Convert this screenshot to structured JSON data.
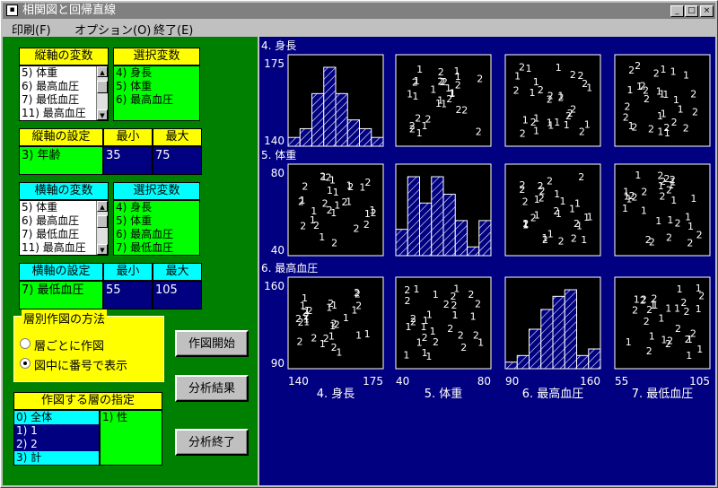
{
  "window": {
    "title": "相関図と回帰直線",
    "min_glyph": "_",
    "max_glyph": "□",
    "close_glyph": "×"
  },
  "menu": [
    "印刷(F)",
    "オプション(O)",
    "終了(E)"
  ],
  "vertical_vars": {
    "header": "縦軸の変数",
    "items": [
      "5) 体重",
      "6) 最高血圧",
      "7) 最低血圧",
      "11) 最高血圧"
    ]
  },
  "vertical_selected": {
    "header": "選択変数",
    "items": [
      "4) 身長",
      "5) 体重",
      "6) 最高血圧"
    ]
  },
  "vertical_setting": {
    "header": "縦軸の設定",
    "min_header": "最小",
    "max_header": "最大",
    "variable": "3) 年齢",
    "min": "35",
    "max": "75"
  },
  "horizontal_vars": {
    "header": "横軸の変数",
    "items": [
      "5) 体重",
      "6) 最高血圧",
      "7) 最低血圧",
      "11) 最高血圧"
    ]
  },
  "horizontal_selected": {
    "header": "選択変数",
    "items": [
      "4) 身長",
      "5) 体重",
      "6) 最高血圧",
      "7) 最低血圧"
    ]
  },
  "horizontal_setting": {
    "header": "横軸の設定",
    "min_header": "最小",
    "max_header": "最大",
    "variable": "7) 最低血圧",
    "min": "55",
    "max": "105"
  },
  "stratify_method": {
    "label": "層別作図の方法",
    "options": [
      "層ごとに作図",
      "図中に番号で表示"
    ],
    "selected": 1
  },
  "layer_spec": {
    "header": "作図する層の指定",
    "items": [
      "0) 全体",
      "1) 1",
      "2) 2",
      "3) 計"
    ],
    "selected_item": "1) 性"
  },
  "buttons": {
    "start": "作図開始",
    "results": "分析結果",
    "end": "分析終了"
  },
  "arrows": {
    "up": "▲",
    "down": "▼"
  },
  "matrix": {
    "row_labels": [
      "4. 身長",
      "5. 体重",
      "6. 最高血圧"
    ],
    "col_labels": [
      "4. 身長",
      "5. 体重",
      "6. 最高血圧",
      "7. 最低血圧"
    ],
    "row_ticks": [
      [
        "175",
        "140"
      ],
      [
        "80",
        "40"
      ],
      [
        "160",
        "90"
      ]
    ],
    "col_ticks": [
      [
        "140",
        "175"
      ],
      [
        "40",
        "80"
      ],
      [
        "90",
        "160"
      ],
      [
        "55",
        "105"
      ]
    ]
  },
  "chart_data": [
    {
      "type": "bar",
      "title": "4. 身長 histogram",
      "values": [
        1,
        2,
        6,
        9,
        6,
        3,
        2,
        1
      ]
    },
    {
      "type": "bar",
      "title": "5. 体重 histogram",
      "values": [
        3,
        9,
        6,
        9,
        7,
        4,
        1,
        4
      ]
    },
    {
      "type": "bar",
      "title": "6. 最高血圧 histogram",
      "values": [
        1,
        2,
        6,
        9,
        11,
        12,
        2,
        3
      ]
    },
    {
      "type": "scatter",
      "title": "stratified points",
      "markers": [
        "1",
        "2"
      ]
    }
  ],
  "colors": {
    "left_bg": "#008000",
    "right_bg": "#000080",
    "yellow": "#ffff00",
    "cyan": "#00ffff",
    "green": "#00ff00"
  }
}
